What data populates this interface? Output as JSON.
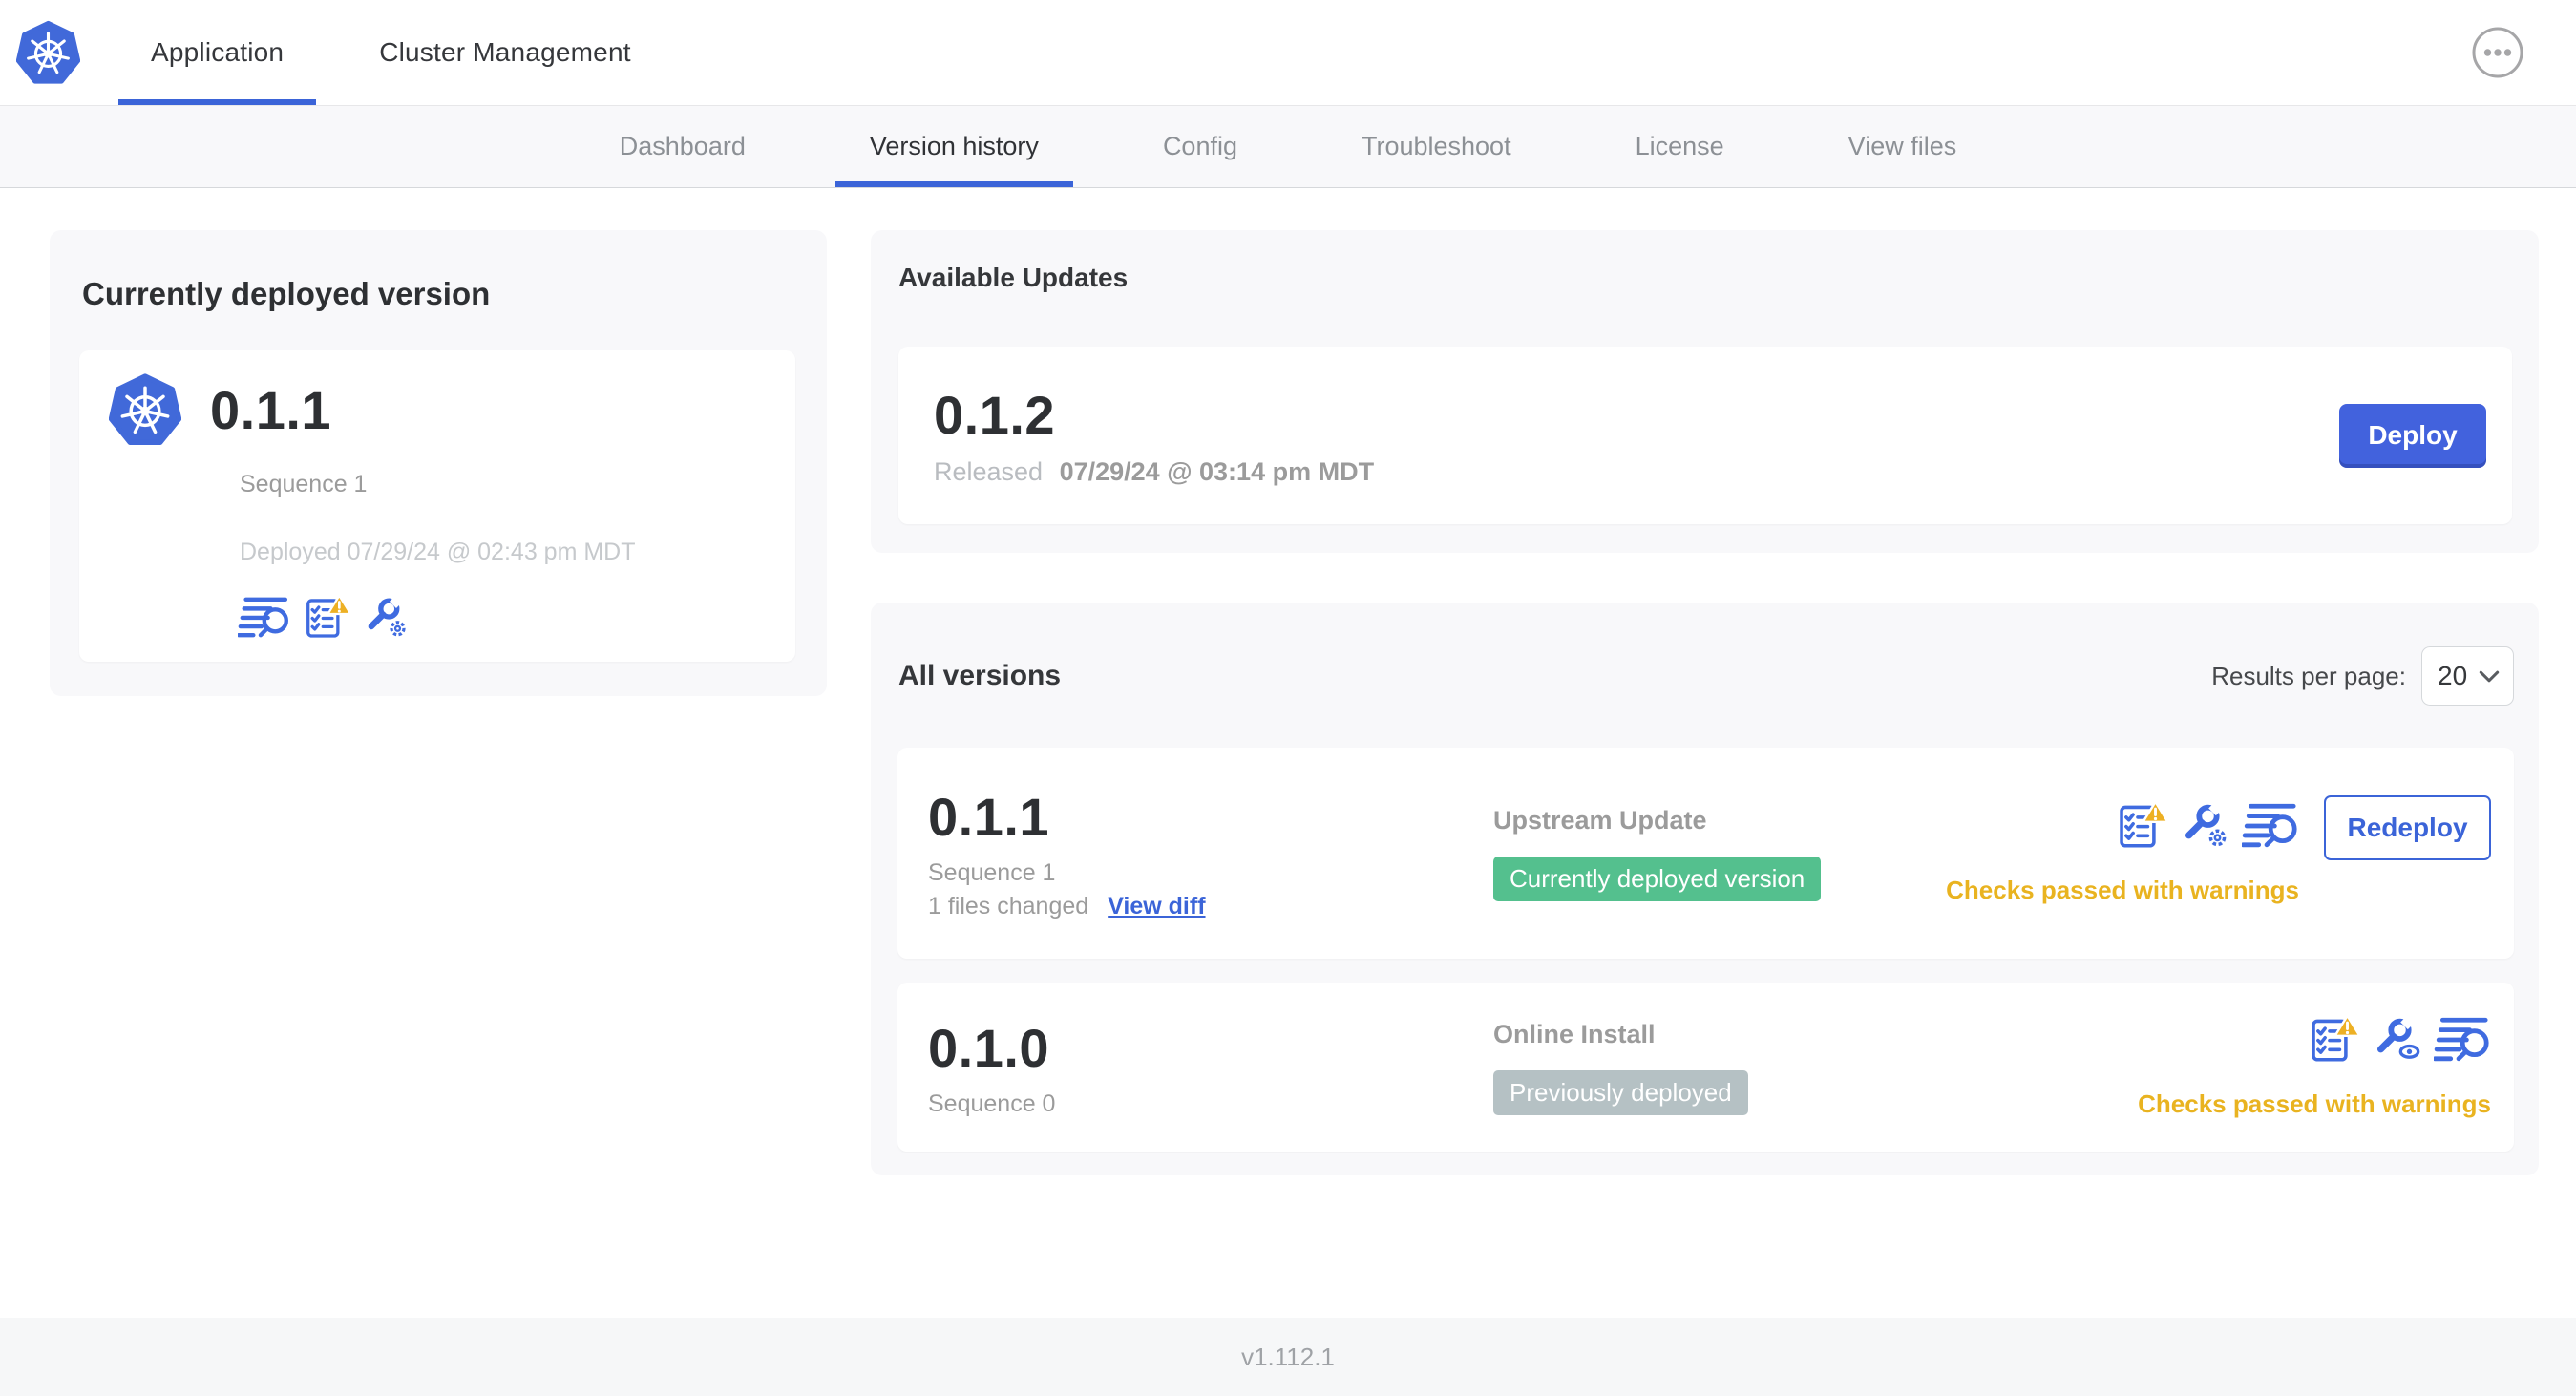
{
  "topbar": {
    "logo_icon": "kubernetes-logo",
    "tabs": [
      {
        "label": "Application"
      },
      {
        "label": "Cluster Management"
      }
    ],
    "active_tab": "Application",
    "menu_icon": "ellipsis-menu-icon"
  },
  "subnav": {
    "items": [
      {
        "label": "Dashboard"
      },
      {
        "label": "Version history"
      },
      {
        "label": "Config"
      },
      {
        "label": "Troubleshoot"
      },
      {
        "label": "License"
      },
      {
        "label": "View files"
      }
    ],
    "active_item": "Version history"
  },
  "deployed_card": {
    "title": "Currently deployed version",
    "version": "0.1.1",
    "sequence": "Sequence 1",
    "deployed_at": "Deployed 07/29/24 @ 02:43 pm MDT",
    "icons": [
      "logs-icon",
      "preflight-checks-warning-icon",
      "config-gear-icon"
    ]
  },
  "available_updates": {
    "title": "Available Updates",
    "version": "0.1.2",
    "released_label": "Released",
    "released_at": "07/29/24 @ 03:14 pm MDT",
    "deploy_button": "Deploy"
  },
  "all_versions": {
    "title": "All versions",
    "results_per_page_label": "Results per page:",
    "results_per_page_value": "20",
    "rows": [
      {
        "version": "0.1.1",
        "sequence": "Sequence 1",
        "files_changed": "1 files changed",
        "view_diff_link": "View diff",
        "source": "Upstream Update",
        "badge": "Currently deployed version",
        "badge_style": "green",
        "icons": [
          "preflight-checks-warning-icon",
          "config-gear-icon",
          "logs-icon"
        ],
        "checks_status": "Checks passed with warnings",
        "action_button": "Redeploy"
      },
      {
        "version": "0.1.0",
        "sequence": "Sequence 0",
        "source": "Online Install",
        "badge": "Previously deployed",
        "badge_style": "gray",
        "icons": [
          "preflight-checks-warning-icon",
          "config-view-icon",
          "logs-icon"
        ],
        "checks_status": "Checks passed with warnings"
      }
    ]
  },
  "footer": {
    "app_version": "v1.112.1"
  },
  "colors": {
    "accent_blue": "#3b64d8",
    "button_blue": "#4262dd",
    "kubernetes_blue": "#4169d9",
    "badge_green": "#54c08e",
    "badge_gray": "#b5c1c4",
    "warning_yellow": "#e9b320"
  }
}
